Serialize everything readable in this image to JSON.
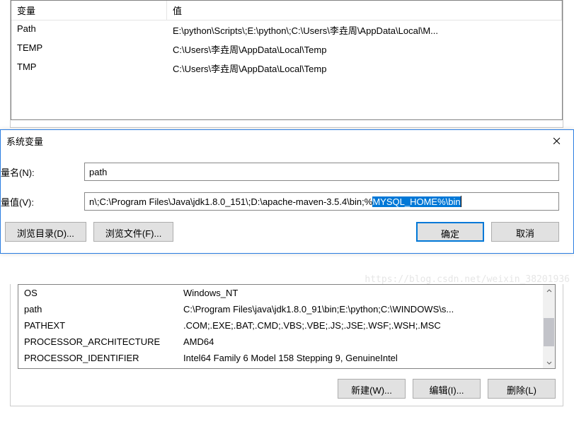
{
  "upperTable": {
    "headers": {
      "col1": "变量",
      "col2": "值"
    },
    "rows": [
      {
        "name": "Path",
        "value": "E:\\python\\Scripts\\;E:\\python\\;C:\\Users\\李垚周\\AppData\\Local\\M..."
      },
      {
        "name": "TEMP",
        "value": "C:\\Users\\李垚周\\AppData\\Local\\Temp"
      },
      {
        "name": "TMP",
        "value": "C:\\Users\\李垚周\\AppData\\Local\\Temp"
      }
    ]
  },
  "dialog": {
    "title": "系统变量",
    "nameLabel": "量名(N):",
    "nameValue": "path",
    "valueLabel": "量值(V):",
    "valuePrefix": "n\\;C:\\Program Files\\Java\\jdk1.8.0_151\\;D:\\apache-maven-3.5.4\\bin;%",
    "valueSelected": "MYSQL_HOME%\\bin",
    "browseDir": "浏览目录(D)...",
    "browseFile": "浏览文件(F)...",
    "ok": "确定",
    "cancel": "取消"
  },
  "lowerTable": {
    "rows": [
      {
        "name": "OS",
        "value": "Windows_NT"
      },
      {
        "name": "path",
        "value": "C:\\Program Files\\java\\jdk1.8.0_91\\bin;E:\\python;C:\\WINDOWS\\s..."
      },
      {
        "name": "PATHEXT",
        "value": ".COM;.EXE;.BAT;.CMD;.VBS;.VBE;.JS;.JSE;.WSF;.WSH;.MSC"
      },
      {
        "name": "PROCESSOR_ARCHITECTURE",
        "value": "AMD64"
      },
      {
        "name": "PROCESSOR_IDENTIFIER",
        "value": "Intel64 Family 6 Model 158 Stepping 9, GenuineIntel"
      }
    ]
  },
  "lowerButtons": {
    "new": "新建(W)...",
    "edit": "编辑(I)...",
    "delete": "删除(L)"
  },
  "watermark": "https://blog.csdn.net/weixin_38201936"
}
